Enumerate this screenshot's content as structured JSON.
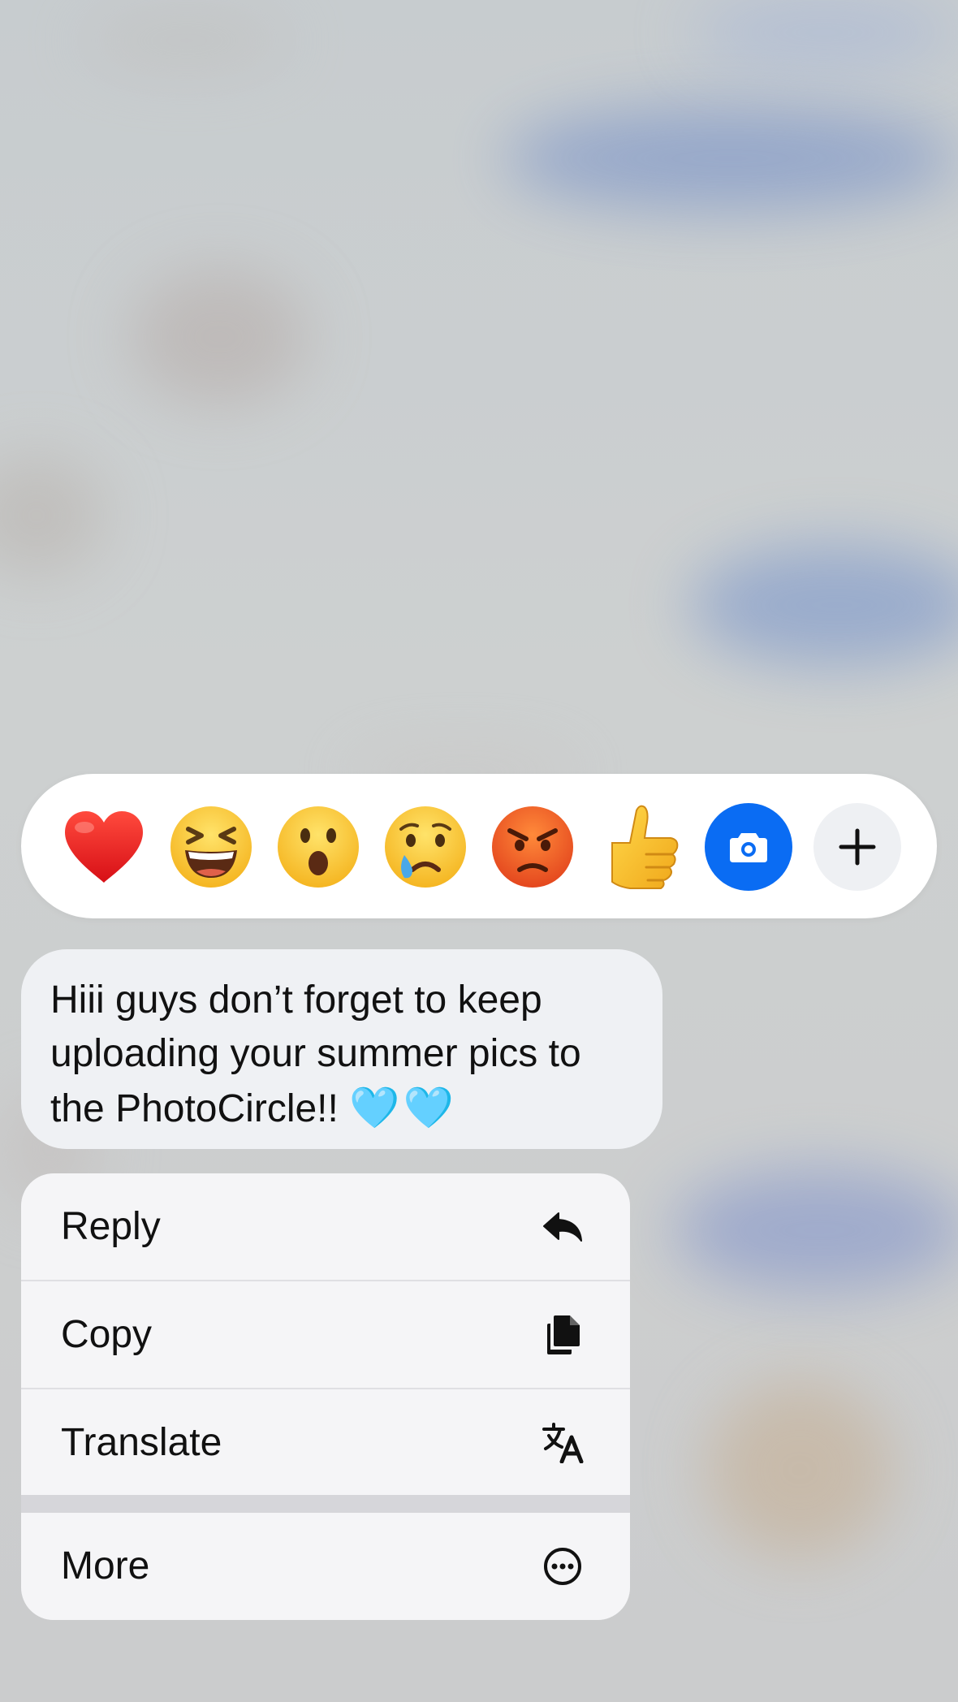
{
  "reactions": [
    {
      "name": "heart",
      "glyph": "❤️"
    },
    {
      "name": "laughing",
      "glyph": "😆"
    },
    {
      "name": "surprised",
      "glyph": "😮"
    },
    {
      "name": "crying",
      "glyph": "😢"
    },
    {
      "name": "angry",
      "glyph": "😡"
    },
    {
      "name": "thumbs-up",
      "glyph": "👍"
    }
  ],
  "reaction_actions": {
    "camera_icon": "camera-icon",
    "add_icon": "plus-icon"
  },
  "message": {
    "text": "Hiii guys don’t forget to keep\nuploading your summer pics to\nthe PhotoCircle!! ",
    "emoji": "🩵🩵"
  },
  "menu": {
    "items": [
      {
        "label": "Reply",
        "icon": "reply-icon"
      },
      {
        "label": "Copy",
        "icon": "copy-icon"
      },
      {
        "label": "Translate",
        "icon": "translate-icon"
      }
    ],
    "more": {
      "label": "More",
      "icon": "more-icon"
    }
  },
  "colors": {
    "camera_button": "#0a6cf3",
    "bubble": "#eff1f4",
    "menu": "#f5f5f7"
  }
}
